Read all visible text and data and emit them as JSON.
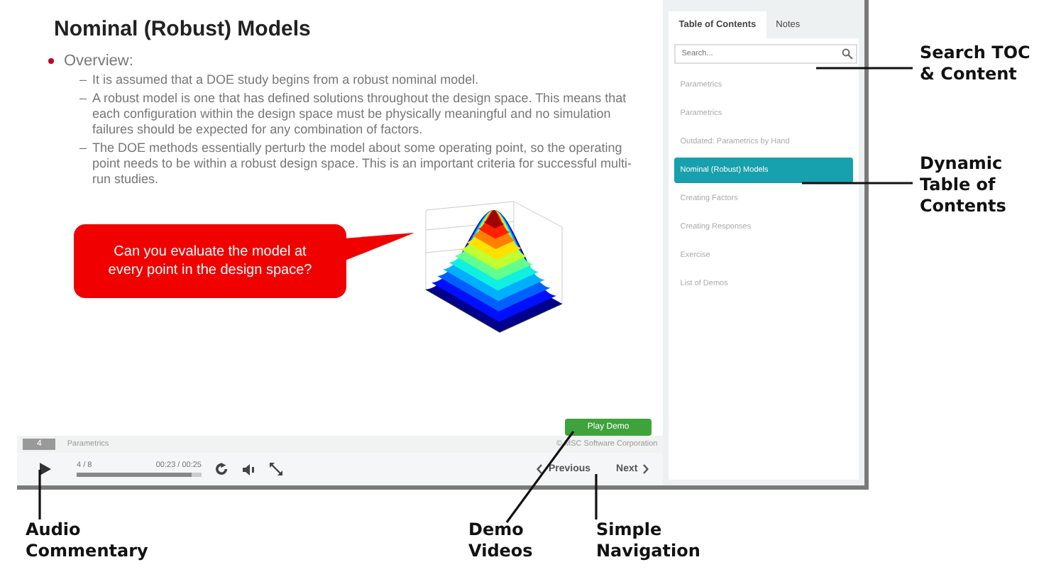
{
  "slide": {
    "title": "Nominal (Robust) Models",
    "bullet": "Overview:",
    "subpoints": [
      {
        "marker": "–",
        "text": "It is assumed that a DOE study begins from a robust nominal model."
      },
      {
        "marker": "–",
        "text": "A robust model is one that has defined solutions throughout the design space. This means that each configuration within the design space must be physically meaningful and no simulation failures should be expected for any combination of factors."
      },
      {
        "marker": "–",
        "text": "The DOE methods essentially perturb the model about some operating point, so the operating point needs to be within a robust design space. This is an important criteria for successful multi-run studies."
      }
    ],
    "callout": "Can you evaluate the model at every point in the design space?",
    "demo_button": "Play Demo",
    "copyright": "© MSC Software Corporation"
  },
  "footer": {
    "slide_number": "4",
    "section": "Parametrics"
  },
  "player": {
    "slide_count": "4 / 8",
    "time": "00:23 / 00:25",
    "level": 0.92,
    "previous": "Previous",
    "next": "Next"
  },
  "toc": {
    "tabs": [
      {
        "label": "Table of Contents",
        "selected": true
      },
      {
        "label": "Notes",
        "selected": false
      }
    ],
    "search": {
      "placeholder": "Search..."
    },
    "items": [
      {
        "label": "Parametrics",
        "selected": false
      },
      {
        "label": "Parametrics",
        "selected": false
      },
      {
        "label": "Outdated: Parametrics by Hand",
        "selected": false
      },
      {
        "label": "Nominal (Robust) Models",
        "selected": true
      },
      {
        "label": "Creating Factors",
        "selected": false
      },
      {
        "label": "Creating Responses",
        "selected": false
      },
      {
        "label": "Exercise",
        "selected": false
      },
      {
        "label": "List of Demos",
        "selected": false
      }
    ]
  },
  "annotations": [
    "Search TOC & Content",
    "Dynamic Table of Contents",
    "Audio Commentary",
    "Demo Videos",
    "Simple Navigation"
  ]
}
